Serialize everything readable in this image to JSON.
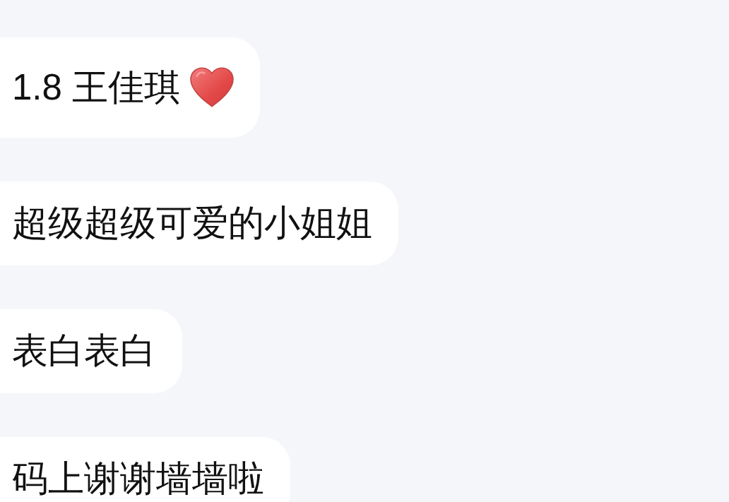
{
  "messages": [
    {
      "kind": "with-heart",
      "text": "1.8 王佳琪"
    },
    {
      "kind": "text",
      "text": "超级超级可爱的小姐姐"
    },
    {
      "kind": "text",
      "text": "表白表白"
    },
    {
      "kind": "text",
      "text": "码上谢谢墙墙啦"
    }
  ]
}
